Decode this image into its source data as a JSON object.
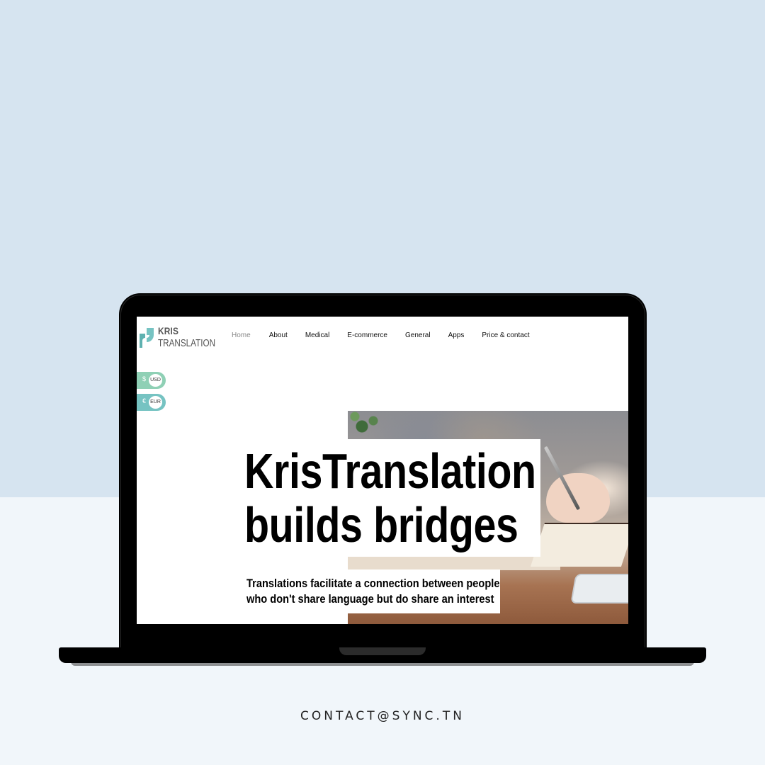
{
  "site": {
    "logo": {
      "line1": "KRIS",
      "line2": "TRANSLATION",
      "accent": "#76c3c2"
    },
    "nav": [
      "Home",
      "About",
      "Medical",
      "E-commerce",
      "General",
      "Apps",
      "Price & contact"
    ],
    "currency": {
      "usd": {
        "symbol": "$",
        "label": "USD"
      },
      "eur": {
        "symbol": "€",
        "label": "EUR"
      }
    },
    "hero": {
      "headline_line1": "KrisTranslation",
      "headline_line2": "builds bridges",
      "subtitle_line1": "Translations facilitate a connection between people",
      "subtitle_line2": "who don't share language but do share an interest"
    }
  },
  "footer": {
    "contact": "CONTACT@SYNC.TN"
  },
  "colors": {
    "bg_top": "#d6e4f0",
    "bg_bottom": "#f1f6fa",
    "teal": "#76c3c2",
    "green": "#8fd0b5"
  }
}
